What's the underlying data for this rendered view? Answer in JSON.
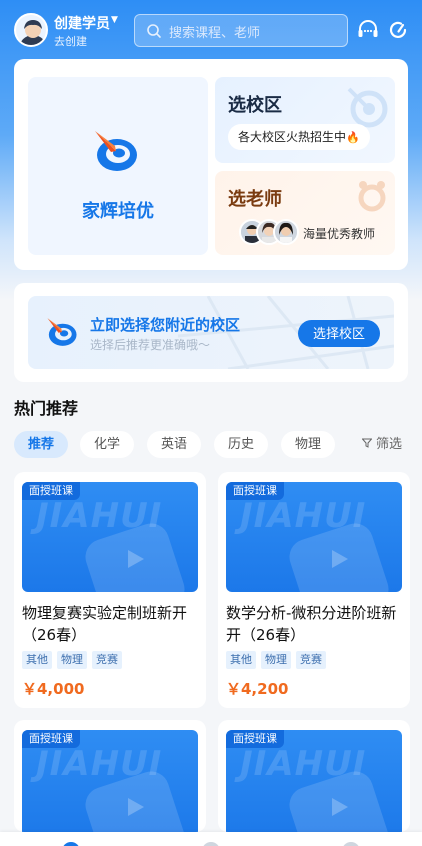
{
  "header": {
    "user_name": "创建学员",
    "user_sub": "去创建",
    "search_placeholder": "搜索课程、老师"
  },
  "feature": {
    "brand_name": "家辉培优",
    "campus_title": "选校区",
    "campus_desc": "各大校区火热招生中",
    "teacher_title": "选老师",
    "teacher_desc": "海量优秀教师"
  },
  "banner": {
    "title": "立即选择您附近的校区",
    "subtitle": "选择后推荐更准确哦～",
    "button_label": "选择校区"
  },
  "section": {
    "title": "热门推荐",
    "chips": [
      "推荐",
      "化学",
      "英语",
      "历史",
      "物理"
    ],
    "active_chip": "推荐",
    "filter_label": "筛选"
  },
  "courses": [
    {
      "badge": "面授班课",
      "watermark": "JIAHUI",
      "title": "物理复赛实验定制班新开（26春）",
      "tags": [
        "其他",
        "物理",
        "竞赛"
      ],
      "price": "￥4,000"
    },
    {
      "badge": "面授班课",
      "watermark": "JIAHUI",
      "title": "数学分析-微积分进阶班新开（26春）",
      "tags": [
        "其他",
        "物理",
        "竞赛"
      ],
      "price": "￥4,200"
    },
    {
      "badge": "面授班课",
      "watermark": "JIAHUI",
      "title": "",
      "tags": [],
      "price": ""
    },
    {
      "badge": "面授班课",
      "watermark": "JIAHUI",
      "title": "",
      "tags": [],
      "price": ""
    }
  ],
  "colors": {
    "primary": "#1677e8",
    "price": "#f06a1f",
    "header_gradient_top": "#2e8ef5"
  },
  "icons": {
    "search": "search-icon",
    "headset": "headset-icon",
    "refresh": "refresh-icon",
    "filter": "filter-icon"
  }
}
